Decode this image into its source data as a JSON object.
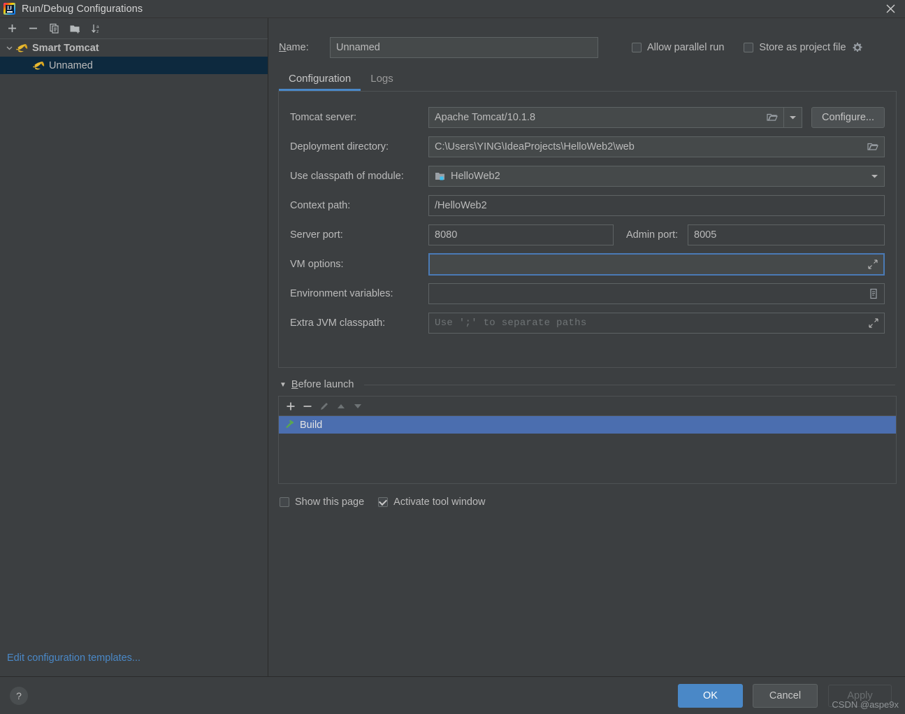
{
  "window": {
    "title": "Run/Debug Configurations",
    "app_icon": "intellij-idea-logo",
    "close_icon": "close-icon"
  },
  "sidebar": {
    "toolbar": [
      {
        "name": "add",
        "icon": "plus-icon"
      },
      {
        "name": "remove",
        "icon": "minus-icon"
      },
      {
        "name": "copy",
        "icon": "copy-icon"
      },
      {
        "name": "new-folder",
        "icon": "folder-add-icon"
      },
      {
        "name": "sort-alphabetically",
        "icon": "sort-az-icon"
      }
    ],
    "tree": {
      "group_label": "Smart Tomcat",
      "group_icon": "tomcat-icon",
      "group_expanded": true,
      "child_label": "Unnamed",
      "child_icon": "tomcat-icon",
      "child_selected": true
    },
    "edit_templates_link": "Edit configuration templates..."
  },
  "header": {
    "name_label": "Name:",
    "name_value": "Unnamed",
    "allow_parallel_run_label": "Allow parallel run",
    "allow_parallel_run_checked": false,
    "store_as_project_file_label": "Store as project file",
    "store_as_project_file_checked": false,
    "gear_icon": "gear-icon"
  },
  "tabs": [
    {
      "label": "Configuration",
      "active": true
    },
    {
      "label": "Logs",
      "active": false
    }
  ],
  "form": {
    "tomcat_server": {
      "label": "Tomcat server:",
      "value": "Apache Tomcat/10.1.8",
      "browse_icon": "folder-open-icon",
      "dropdown_icon": "chevron-down-icon",
      "configure_button": "Configure..."
    },
    "deployment_directory": {
      "label": "Deployment directory:",
      "value": "C:\\Users\\YING\\IdeaProjects\\HelloWeb2\\web",
      "browse_icon": "folder-open-icon"
    },
    "classpath_module": {
      "label": "Use classpath of module:",
      "value": "HelloWeb2",
      "module_icon": "module-folder-icon",
      "dropdown_icon": "chevron-down-icon"
    },
    "context_path": {
      "label": "Context path:",
      "value": "/HelloWeb2"
    },
    "server_port": {
      "label": "Server port:",
      "value": "8080"
    },
    "admin_port": {
      "label": "Admin port:",
      "value": "8005"
    },
    "vm_options": {
      "label": "VM options:",
      "value": "",
      "placeholder": "",
      "focused": true,
      "expand_icon": "expand-icon"
    },
    "environment_variables": {
      "label": "Environment variables:",
      "value": "",
      "list_icon": "list-edit-icon"
    },
    "extra_jvm_classpath": {
      "label": "Extra JVM classpath:",
      "value": "",
      "placeholder": "Use ';' to separate paths",
      "expand_icon": "expand-icon"
    }
  },
  "before_launch": {
    "title": "Before launch",
    "expanded": true,
    "toolbar": [
      {
        "name": "add-task",
        "icon": "plus-icon",
        "enabled": true
      },
      {
        "name": "remove-task",
        "icon": "minus-icon",
        "enabled": true
      },
      {
        "name": "edit-task",
        "icon": "pencil-icon",
        "enabled": false
      },
      {
        "name": "move-up",
        "icon": "arrow-up-icon",
        "enabled": false
      },
      {
        "name": "move-down",
        "icon": "arrow-down-icon",
        "enabled": false
      }
    ],
    "tasks": [
      {
        "label": "Build",
        "icon": "hammer-icon",
        "selected": true
      }
    ],
    "show_this_page_label": "Show this page",
    "show_this_page_checked": false,
    "activate_tool_window_label": "Activate tool window",
    "activate_tool_window_checked": true
  },
  "footer": {
    "help_label": "?",
    "ok_label": "OK",
    "cancel_label": "Cancel",
    "apply_label": "Apply",
    "apply_enabled": false
  },
  "watermark": "CSDN @aspe9x",
  "colors": {
    "background": "#3c3f41",
    "field_background": "#45494a",
    "border": "#5e6364",
    "accent_blue": "#4a88c7",
    "selection_blue": "#4b6eaf",
    "tree_selection": "#0d293e",
    "link_blue": "#4a88c7",
    "text": "#bbbbbb",
    "tomcat_yellow": "#e8b930",
    "hammer_green": "#5aa84f",
    "module_badge": "#3dc0f0"
  }
}
